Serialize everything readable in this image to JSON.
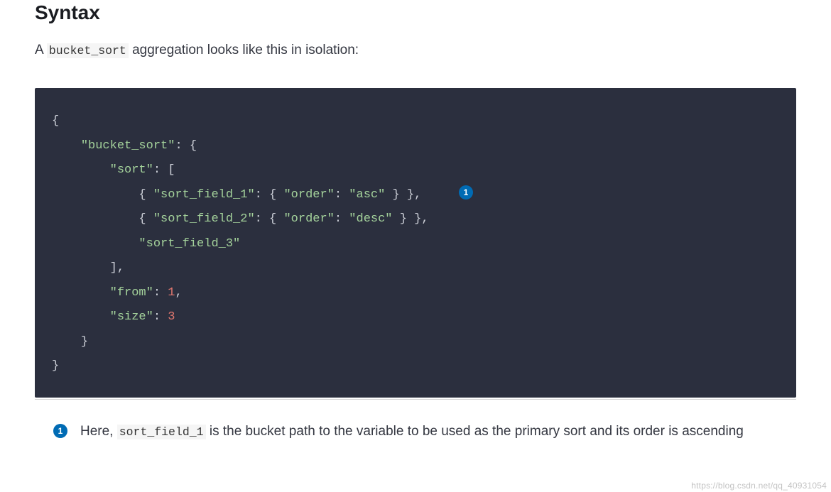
{
  "section_title": "Syntax",
  "intro": {
    "prefix": "A ",
    "code": "bucket_sort",
    "suffix": " aggregation looks like this in isolation:"
  },
  "code": {
    "lines": [
      {
        "prefix": "",
        "segments": [
          {
            "t": "{",
            "c": "punc"
          }
        ]
      },
      {
        "prefix": "    ",
        "segments": [
          {
            "t": "\"bucket_sort\"",
            "c": "str"
          },
          {
            "t": ": {",
            "c": "punc"
          }
        ]
      },
      {
        "prefix": "        ",
        "segments": [
          {
            "t": "\"sort\"",
            "c": "str"
          },
          {
            "t": ": [",
            "c": "punc"
          }
        ]
      },
      {
        "prefix": "            ",
        "segments": [
          {
            "t": "{ ",
            "c": "punc"
          },
          {
            "t": "\"sort_field_1\"",
            "c": "str"
          },
          {
            "t": ": { ",
            "c": "punc"
          },
          {
            "t": "\"order\"",
            "c": "str"
          },
          {
            "t": ": ",
            "c": "punc"
          },
          {
            "t": "\"asc\"",
            "c": "str"
          },
          {
            "t": " } },",
            "c": "punc"
          }
        ],
        "callout": "1"
      },
      {
        "prefix": "            ",
        "segments": [
          {
            "t": "{ ",
            "c": "punc"
          },
          {
            "t": "\"sort_field_2\"",
            "c": "str"
          },
          {
            "t": ": { ",
            "c": "punc"
          },
          {
            "t": "\"order\"",
            "c": "str"
          },
          {
            "t": ": ",
            "c": "punc"
          },
          {
            "t": "\"desc\"",
            "c": "str"
          },
          {
            "t": " } },",
            "c": "punc"
          }
        ]
      },
      {
        "prefix": "            ",
        "segments": [
          {
            "t": "\"sort_field_3\"",
            "c": "str"
          }
        ]
      },
      {
        "prefix": "        ",
        "segments": [
          {
            "t": "],",
            "c": "punc"
          }
        ]
      },
      {
        "prefix": "        ",
        "segments": [
          {
            "t": "\"from\"",
            "c": "str"
          },
          {
            "t": ": ",
            "c": "punc"
          },
          {
            "t": "1",
            "c": "num"
          },
          {
            "t": ",",
            "c": "punc"
          }
        ]
      },
      {
        "prefix": "        ",
        "segments": [
          {
            "t": "\"size\"",
            "c": "str"
          },
          {
            "t": ": ",
            "c": "punc"
          },
          {
            "t": "3",
            "c": "num"
          }
        ]
      },
      {
        "prefix": "    ",
        "segments": [
          {
            "t": "}",
            "c": "punc"
          }
        ]
      },
      {
        "prefix": "",
        "segments": [
          {
            "t": "}",
            "c": "punc"
          }
        ]
      }
    ]
  },
  "footnotes": [
    {
      "badge": "1",
      "parts": [
        {
          "type": "text",
          "value": "Here, "
        },
        {
          "type": "code",
          "value": "sort_field_1"
        },
        {
          "type": "text",
          "value": " is the bucket path to the variable to be used as the primary sort and its order is ascending"
        }
      ]
    }
  ],
  "watermark": "https://blog.csdn.net/qq_40931054"
}
